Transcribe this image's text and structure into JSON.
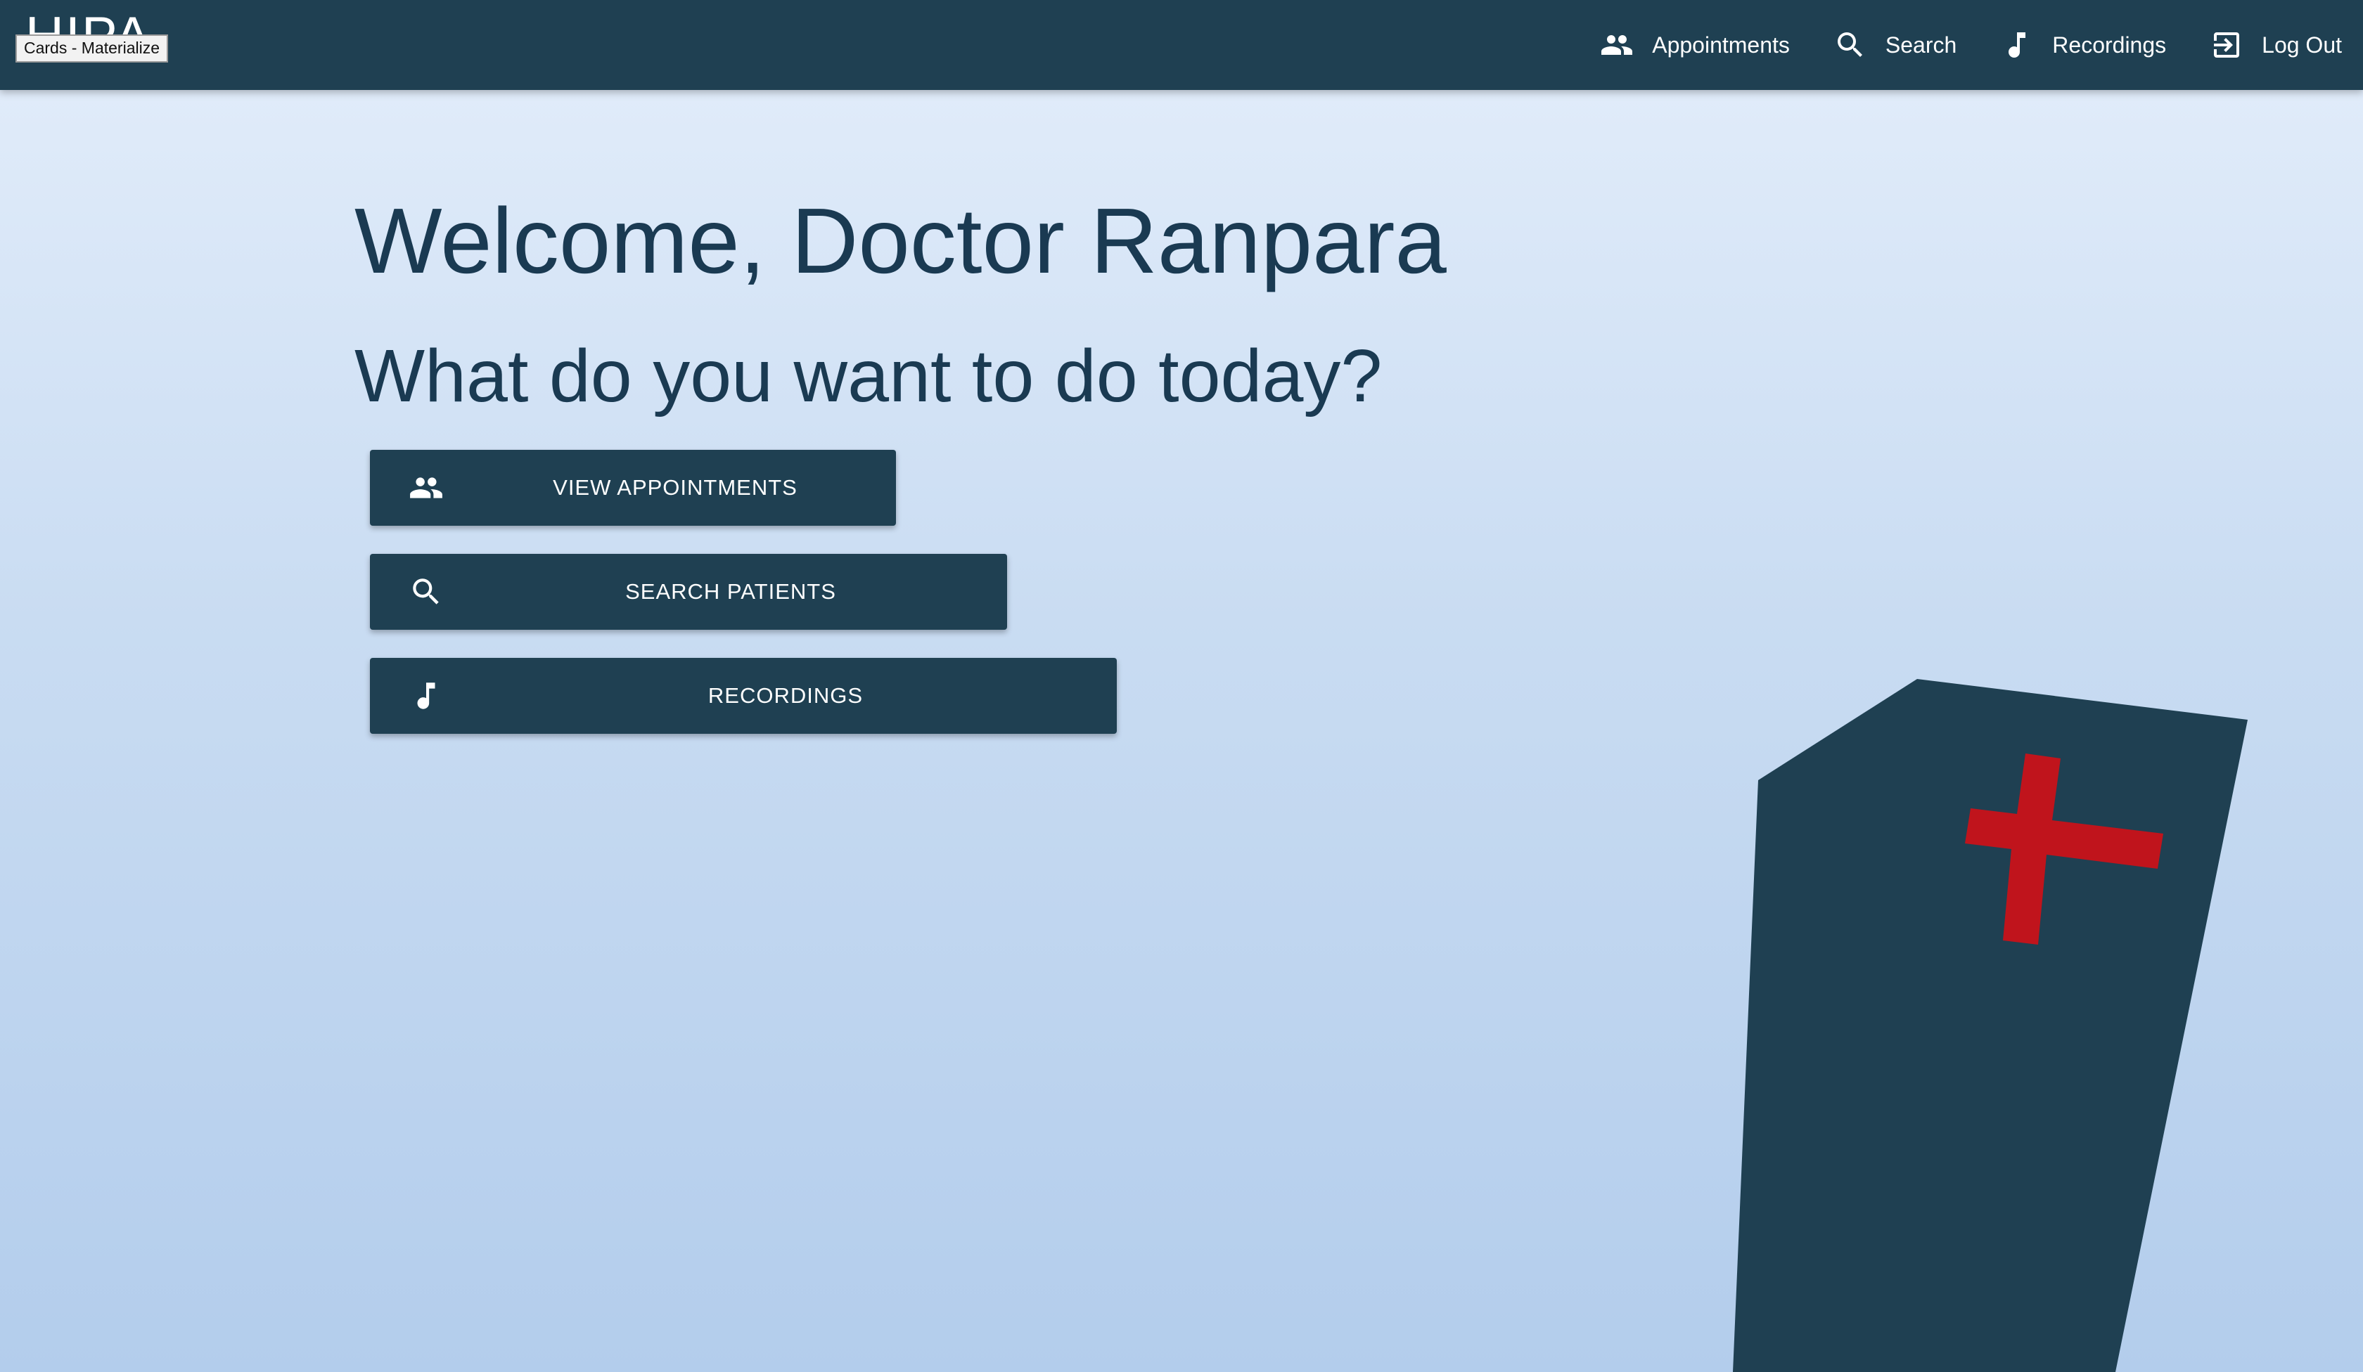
{
  "navbar": {
    "brand": "HIPA",
    "tooltip": "Cards - Materialize",
    "links": [
      {
        "label": "Appointments",
        "icon": "people-icon"
      },
      {
        "label": "Search",
        "icon": "search-icon"
      },
      {
        "label": "Recordings",
        "icon": "music-note-icon"
      },
      {
        "label": "Log Out",
        "icon": "logout-icon"
      }
    ]
  },
  "main": {
    "welcome": "Welcome, Doctor Ranpara",
    "question": "What do you want to do today?",
    "actions": [
      {
        "label": "VIEW APPOINTMENTS",
        "icon": "people-icon"
      },
      {
        "label": "SEARCH PATIENTS",
        "icon": "search-icon"
      },
      {
        "label": "RECORDINGS",
        "icon": "music-note-icon"
      }
    ]
  },
  "colors": {
    "primary": "#1f4052",
    "heading": "#1a3a52",
    "cross": "#c0141c",
    "background_top": "#e4eefb",
    "background_bottom": "#b3cdec"
  }
}
